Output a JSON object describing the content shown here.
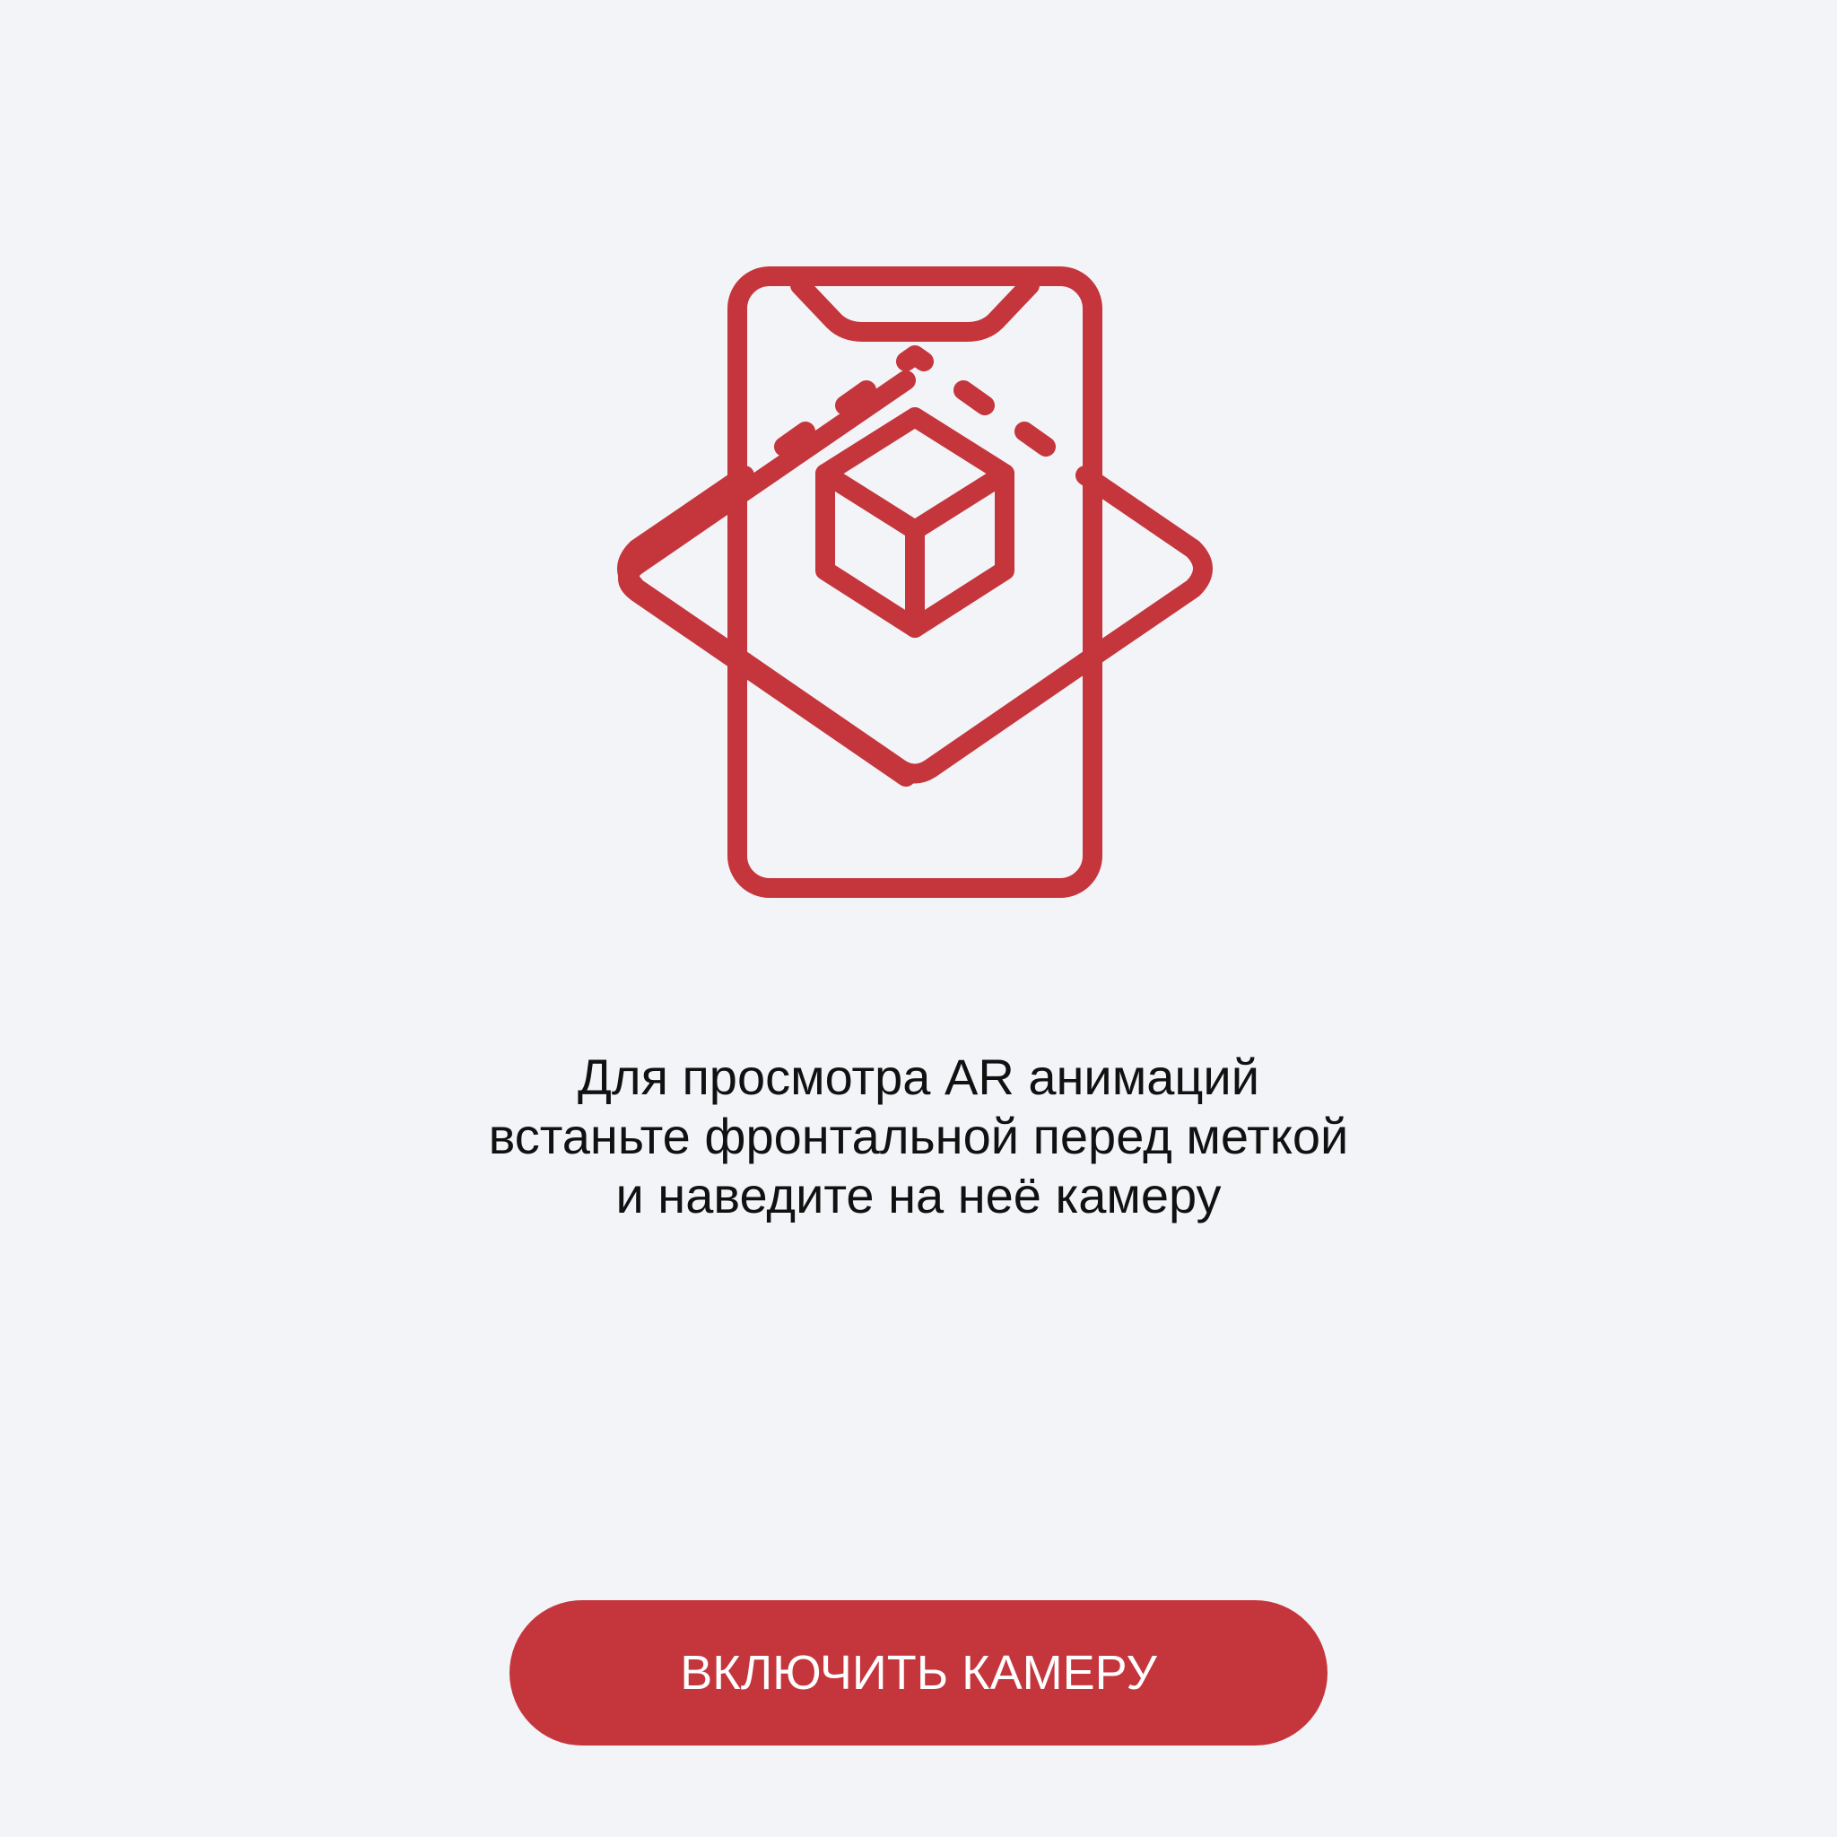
{
  "colors": {
    "background": "#f3f4f8",
    "accent": "#c5353c",
    "text": "#111111",
    "button_text": "#ffffff"
  },
  "icon": {
    "name": "ar-phone-cube-icon"
  },
  "instruction": {
    "lines": [
      "Для просмотра AR анимаций",
      "встаньте фронтальной перед меткой",
      "и наведите на неё камеру"
    ]
  },
  "button": {
    "label": "ВКЛЮЧИТЬ КАМЕРУ"
  }
}
